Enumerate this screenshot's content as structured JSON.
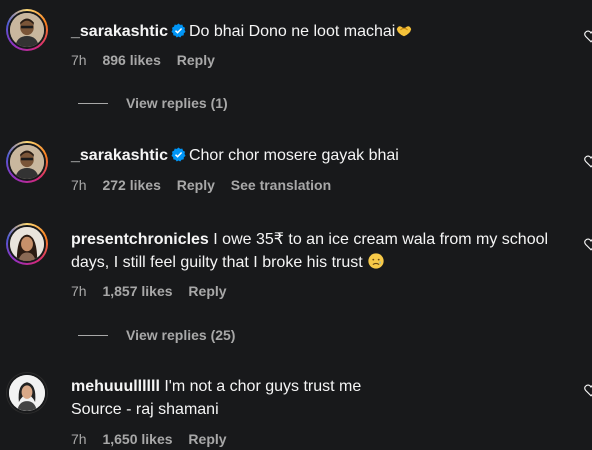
{
  "comments": [
    {
      "username": "_sarakashtic",
      "verified": true,
      "text": "Do bhai Dono ne loot machai",
      "time": "7h",
      "likes": "896 likes",
      "reply": "Reply"
    },
    {
      "username": "_sarakashtic",
      "verified": true,
      "text": "Chor chor mosere gayak bhai",
      "time": "7h",
      "likes": "272 likes",
      "reply": "Reply",
      "see_translation": "See translation"
    },
    {
      "username": "presentchronicles",
      "verified": false,
      "text": "I owe 35₹ to an ice cream wala from my school days, I still feel guilty that I broke his trust",
      "time": "7h",
      "likes": "1,857 likes",
      "reply": "Reply"
    },
    {
      "username": "mehuuullllll",
      "verified": false,
      "text_line1": "I'm not a chor guys trust me",
      "text_line2": "Source - raj shamani",
      "time": "7h",
      "likes": "1,650 likes",
      "reply": "Reply"
    }
  ],
  "view_replies": [
    "View replies (1)",
    "View replies (25)"
  ],
  "icons": {
    "verified": "verified-badge-icon",
    "heart": "heart-outline-icon",
    "emoji_heart_hands": "heart-hands-emoji",
    "emoji_sad": "sad-face-emoji"
  },
  "colors": {
    "background": "#18191b",
    "text_primary": "#f5f5f5",
    "text_secondary": "#a8a8a8",
    "verified_blue": "#0095f6"
  }
}
